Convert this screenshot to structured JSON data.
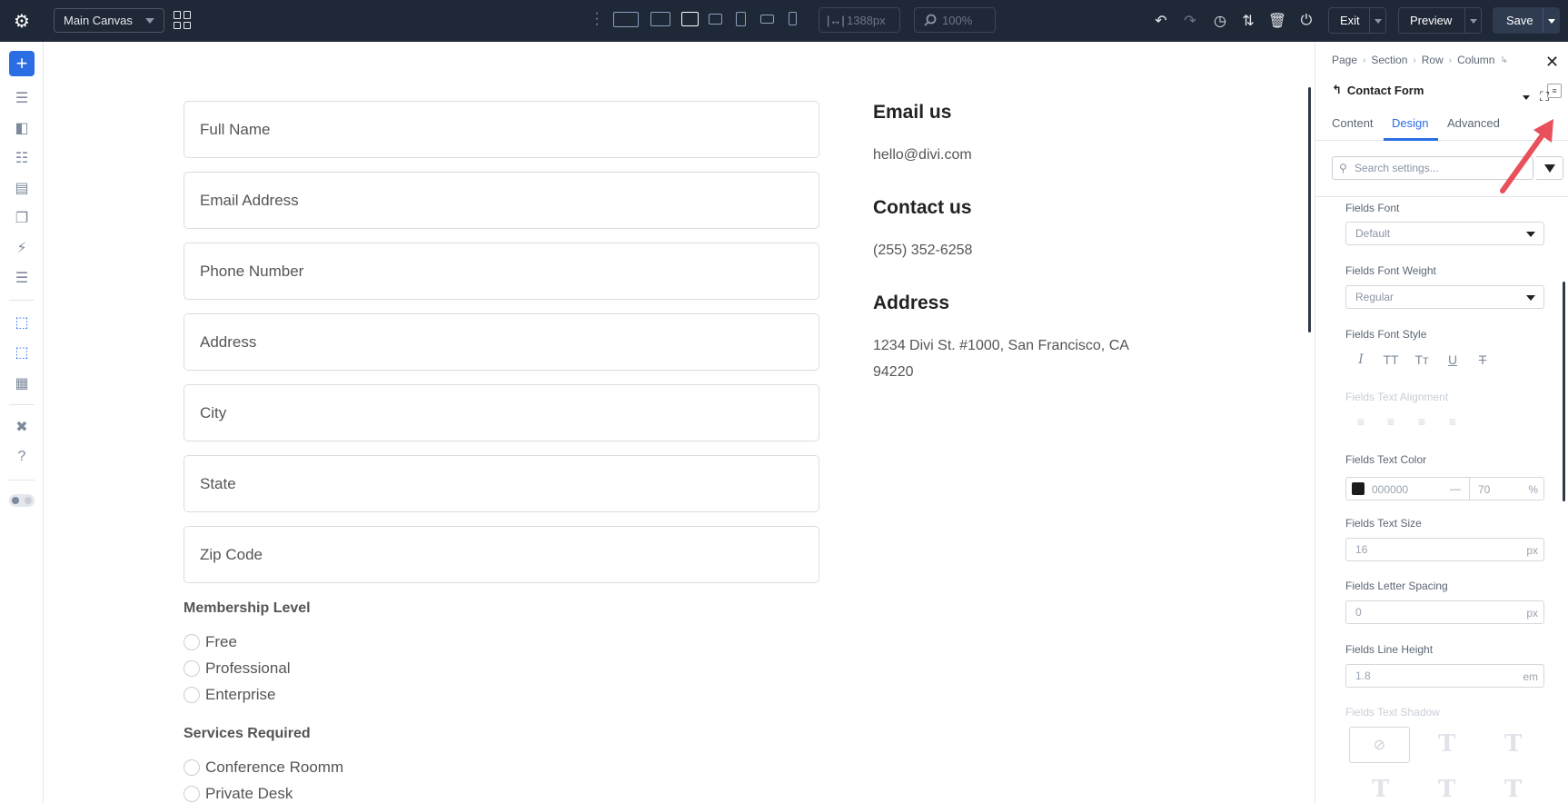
{
  "toolbar": {
    "canvas_select": "Main Canvas",
    "width_value": "1388px",
    "zoom_value": "100%",
    "exit_label": "Exit",
    "preview_label": "Preview",
    "save_label": "Save"
  },
  "canvas": {
    "fields": [
      "Full Name",
      "Email Address",
      "Phone Number",
      "Address",
      "City",
      "State",
      "Zip Code"
    ],
    "membership": {
      "title": "Membership Level",
      "options": [
        "Free",
        "Professional",
        "Enterprise"
      ]
    },
    "services": {
      "title": "Services Required",
      "options": [
        "Conference Roomm",
        "Private Desk"
      ]
    },
    "info": {
      "email_heading": "Email us",
      "email_value": "hello@divi.com",
      "contact_heading": "Contact us",
      "contact_value": "(255) 352-6258",
      "address_heading": "Address",
      "address_line1": "1234 Divi St. #1000, San Francisco, CA",
      "address_line2": "94220"
    }
  },
  "panel": {
    "breadcrumbs": [
      "Page",
      "Section",
      "Row",
      "Column"
    ],
    "module_title": "Contact Form",
    "tabs": [
      "Content",
      "Design",
      "Advanced"
    ],
    "active_tab": "Design",
    "search_placeholder": "Search settings...",
    "settings": {
      "fields_font_label": "Fields Font",
      "fields_font_value": "Default",
      "fields_font_weight_label": "Fields Font Weight",
      "fields_font_weight_value": "Regular",
      "fields_font_style_label": "Fields Font Style",
      "fields_text_alignment_label": "Fields Text Alignment",
      "fields_text_color_label": "Fields Text Color",
      "fields_text_color_hex": "000000",
      "fields_text_color_dash": "—",
      "fields_text_color_opacity": "70",
      "fields_text_color_unit": "%",
      "fields_text_size_label": "Fields Text Size",
      "fields_text_size_value": "16",
      "fields_text_size_unit": "px",
      "fields_letter_spacing_label": "Fields Letter Spacing",
      "fields_letter_spacing_value": "0",
      "fields_letter_spacing_unit": "px",
      "fields_line_height_label": "Fields Line Height",
      "fields_line_height_value": "1.8",
      "fields_line_height_unit": "em",
      "fields_text_shadow_label": "Fields Text Shadow"
    }
  },
  "colors": {
    "topbar_bg": "#1f2836",
    "accent": "#2b6de3",
    "annotation_arrow": "#e8505b"
  }
}
